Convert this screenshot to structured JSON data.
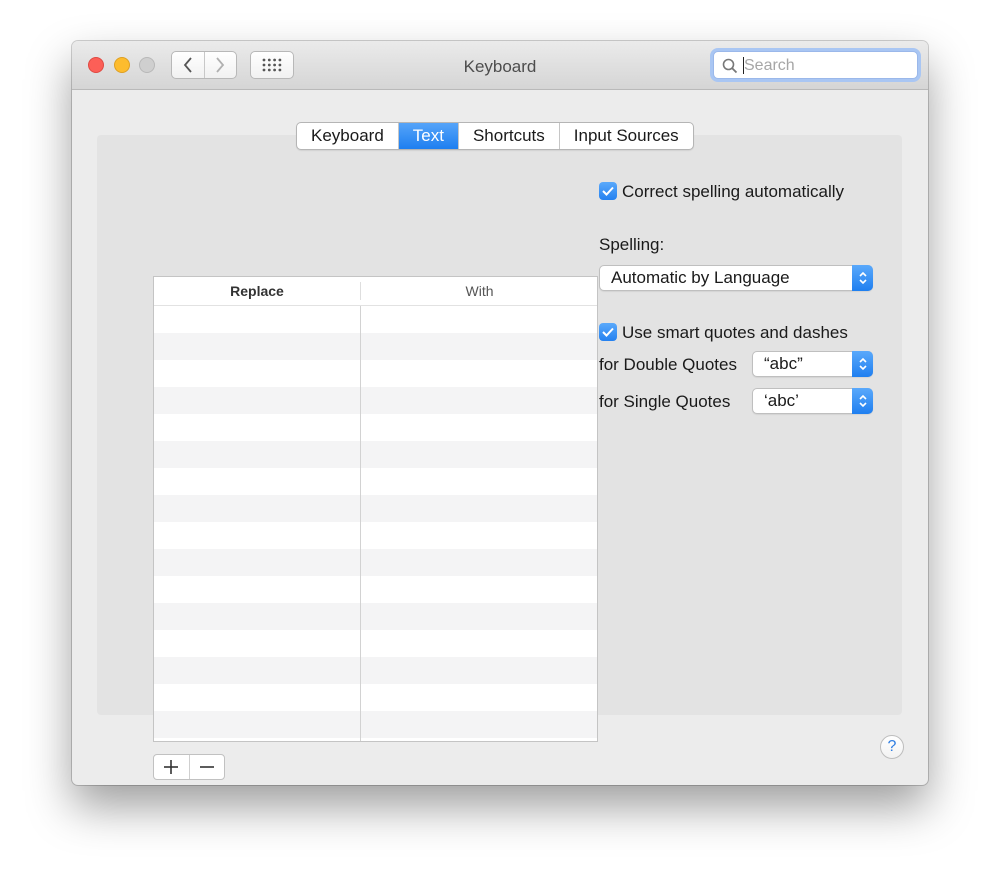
{
  "window": {
    "title": "Keyboard"
  },
  "search": {
    "placeholder": "Search",
    "value": ""
  },
  "tabs": [
    {
      "label": "Keyboard",
      "selected": false
    },
    {
      "label": "Text",
      "selected": true
    },
    {
      "label": "Shortcuts",
      "selected": false
    },
    {
      "label": "Input Sources",
      "selected": false
    }
  ],
  "table": {
    "columns": [
      "Replace",
      "With"
    ],
    "rows": []
  },
  "table_controls": {
    "add": "+",
    "remove": "–"
  },
  "settings": {
    "correct_spelling": {
      "label": "Correct spelling automatically",
      "checked": true
    },
    "spelling": {
      "label": "Spelling:",
      "selected": "Automatic by Language"
    },
    "smart_quotes": {
      "label": "Use smart quotes and dashes",
      "checked": true
    },
    "double_quotes": {
      "label": "for Double Quotes",
      "selected": "“abc”"
    },
    "single_quotes": {
      "label": "for Single Quotes",
      "selected": "‘abc’"
    }
  },
  "help": {
    "label": "?"
  },
  "colors": {
    "accent": "#1e7ff0",
    "close": "#fc5f57",
    "minimize": "#fdbc2e"
  }
}
